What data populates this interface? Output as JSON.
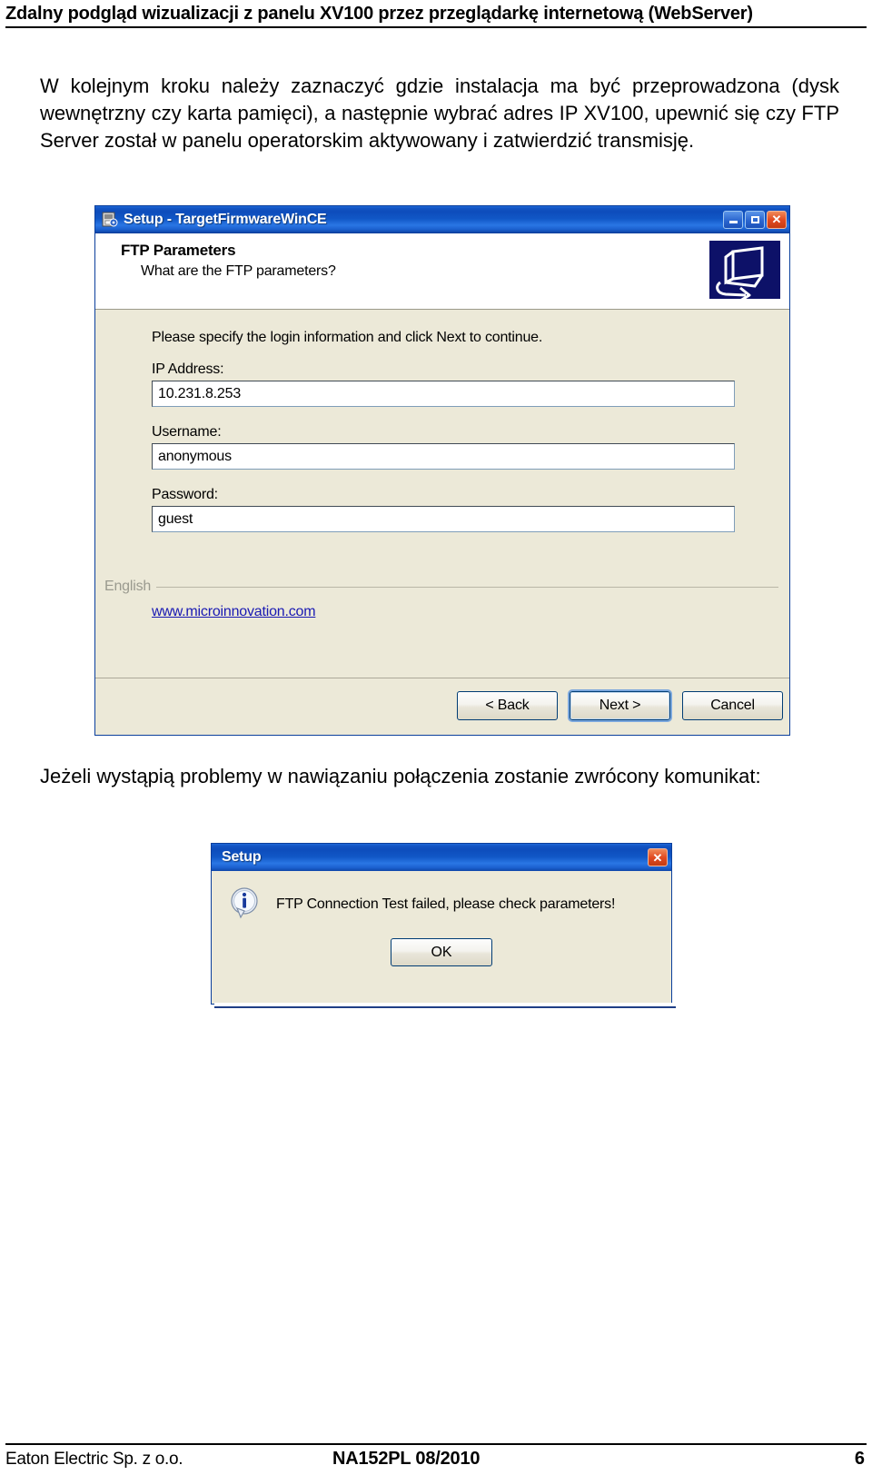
{
  "header": {
    "title": "Zdalny podgląd wizualizacji z panelu XV100 przez przeglądarkę internetową (WebServer)"
  },
  "paragraphs": {
    "intro": "W kolejnym kroku należy zaznaczyć gdzie instalacja ma być przeprowadzona (dysk wewnętrzny czy karta pamięci), a następnie wybrać adres IP XV100, upewnić się czy FTP Server został w panelu operatorskim aktywowany i zatwierdzić transmisję.",
    "error_intro": "Jeżeli wystąpią problemy w nawiązaniu połączenia zostanie zwrócony komunikat:"
  },
  "setup_window": {
    "title": "Setup - TargetFirmwareWinCE",
    "titlebar_icon": "setup-installer-icon",
    "window_buttons": {
      "minimize": "−",
      "maximize": "□",
      "close": "✕"
    },
    "header": {
      "title": "FTP Parameters",
      "subtitle": "What are the FTP parameters?",
      "icon": "remote-computer-icon"
    },
    "intro_text": "Please specify the login information and click Next to continue.",
    "fields": [
      {
        "label": "IP Address:",
        "value": "10.231.8.253",
        "name": "ip-address"
      },
      {
        "label": "Username:",
        "value": "anonymous",
        "name": "username"
      },
      {
        "label": "Password:",
        "value": "guest",
        "name": "password"
      }
    ],
    "language": "English",
    "link": "www.microinnovation.com",
    "buttons": {
      "back": "< Back",
      "next": "Next >",
      "cancel": "Cancel"
    }
  },
  "message_dialog": {
    "title": "Setup",
    "close_glyph": "✕",
    "icon": "info-icon",
    "text": "FTP Connection Test failed, please check parameters!",
    "ok_label": "OK"
  },
  "footer": {
    "company": "Eaton Electric Sp. z o.o.",
    "doc_id": "NA152PL 08/2010",
    "page_number": "6"
  },
  "colors": {
    "titlebar_blue": "#0d4cbb",
    "dialog_face": "#ece9d8",
    "link_blue": "#1919b3",
    "close_red": "#e24b22"
  }
}
